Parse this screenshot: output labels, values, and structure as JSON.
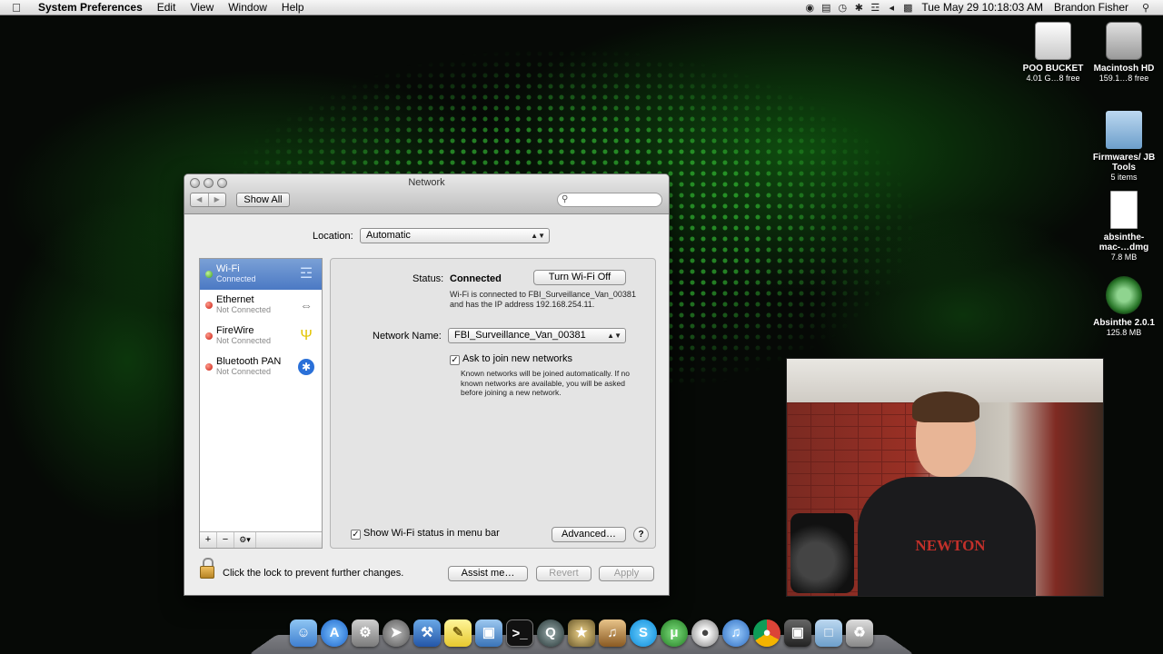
{
  "menubar": {
    "app_name": "System Preferences",
    "menus": [
      "Edit",
      "View",
      "Window",
      "Help"
    ],
    "clock": "Tue May 29  10:18:03 AM",
    "user": "Brandon Fisher"
  },
  "desktop": {
    "icons": [
      {
        "name": "POO BUCKET",
        "detail": "4.01 G…8 free",
        "icon": "external-drive-icon"
      },
      {
        "name": "Macintosh HD",
        "detail": "159.1…8 free",
        "icon": "hard-drive-icon"
      },
      {
        "name": "Firmwares/ JB Tools",
        "detail": "5 items",
        "icon": "folder-icon"
      },
      {
        "name": "absinthe-mac-…dmg",
        "detail": "7.8 MB",
        "icon": "disk-image-icon"
      },
      {
        "name": "Absinthe 2.0.1",
        "detail": "125.8 MB",
        "icon": "absinthe-app-icon"
      }
    ]
  },
  "window": {
    "title": "Network",
    "toolbar": {
      "back": "◀",
      "forward": "▶",
      "show_all": "Show All",
      "search_placeholder": ""
    },
    "location": {
      "label": "Location:",
      "value": "Automatic"
    },
    "services": [
      {
        "name": "Wi-Fi",
        "status": "Connected",
        "state": "green",
        "icon": "wifi-icon",
        "selected": true
      },
      {
        "name": "Ethernet",
        "status": "Not Connected",
        "state": "red",
        "icon": "ethernet-icon",
        "selected": false
      },
      {
        "name": "FireWire",
        "status": "Not Connected",
        "state": "red",
        "icon": "firewire-icon",
        "selected": false
      },
      {
        "name": "Bluetooth PAN",
        "status": "Not Connected",
        "state": "red",
        "icon": "bluetooth-icon",
        "selected": false
      }
    ],
    "list_toolbar": {
      "add": "+",
      "remove": "−",
      "gear": "⚙▾"
    },
    "detail": {
      "status_label": "Status:",
      "status_value": "Connected",
      "turn_off_button": "Turn Wi-Fi Off",
      "status_description": "Wi-Fi is connected to FBI_Surveillance_Van_00381 and has the IP address 192.168.254.11.",
      "network_name_label": "Network Name:",
      "network_name_value": "FBI_Surveillance_Van_00381",
      "ask_to_join_label": "Ask to join new networks",
      "ask_to_join_checked": true,
      "ask_to_join_description": "Known networks will be joined automatically. If no known networks are available, you will be asked before joining a new network.",
      "show_status_label": "Show Wi-Fi status in menu bar",
      "show_status_checked": true,
      "advanced_button": "Advanced…",
      "help_button": "?"
    },
    "footer": {
      "lock_text": "Click the lock to prevent further changes.",
      "assist_button": "Assist me…",
      "revert_button": "Revert",
      "apply_button": "Apply"
    }
  },
  "webcam": {
    "shirt_text": "NEWTON"
  },
  "dock": {
    "items": [
      "finder",
      "app-store",
      "system-preferences",
      "launchpad",
      "xcode",
      "stickies",
      "preview",
      "terminal",
      "quicktime",
      "imovie",
      "garageband",
      "skype",
      "utorrent",
      "dvd-player",
      "itunes",
      "chrome",
      "photo-booth",
      "documents-stack",
      "trash"
    ]
  }
}
